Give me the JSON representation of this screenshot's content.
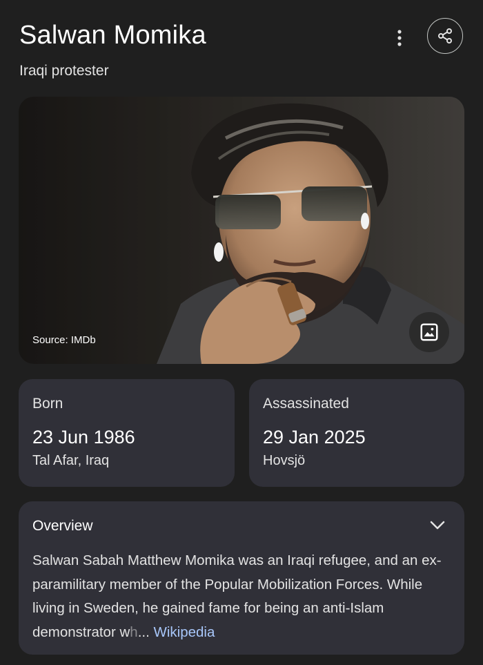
{
  "header": {
    "title": "Salwan Momika",
    "subtitle": "Iraqi protester",
    "more_icon": "more-vert-icon",
    "share_icon": "share-icon"
  },
  "image": {
    "source_label": "Source: IMDb",
    "gallery_icon": "image-icon"
  },
  "born": {
    "label": "Born",
    "date": "23 Jun 1986",
    "place": "Tal Afar, Iraq"
  },
  "died": {
    "label": "Assassinated",
    "date": "29 Jan 2025",
    "place": "Hovsjö"
  },
  "overview": {
    "label": "Overview",
    "text": "Salwan Sabah Matthew Momika was an Iraqi refugee, and an ex-paramilitary member of the Popular Mobilization Forces. While living in Sweden, he gained fame for being an anti-Islam demonstrator w",
    "text_faded": "h",
    "ellipsis": "... ",
    "link_label": "Wikipedia",
    "expand_icon": "chevron-down-icon"
  },
  "colors": {
    "background": "#1f1f1f",
    "card": "#303038",
    "link": "#a8c7fa"
  }
}
